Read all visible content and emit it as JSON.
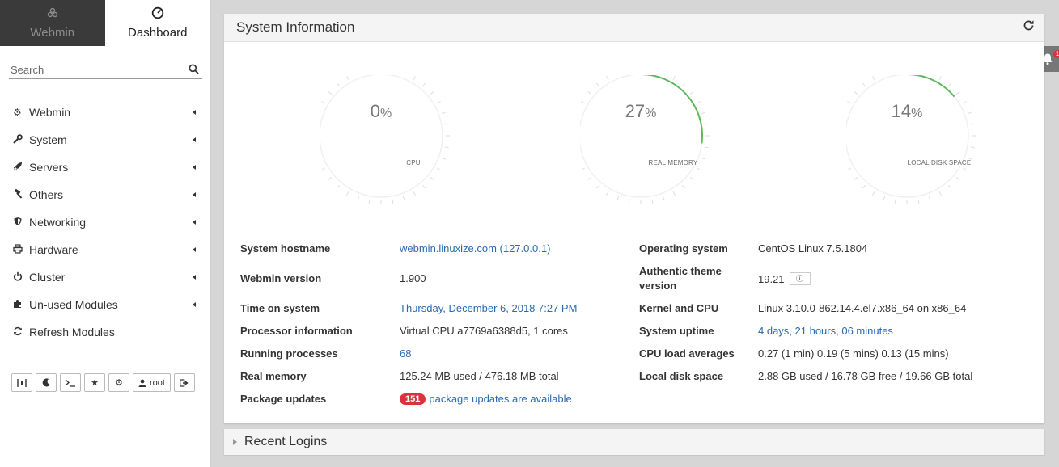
{
  "sidebar": {
    "tabs": [
      {
        "label": "Webmin",
        "icon": "webmin-logo-icon"
      },
      {
        "label": "Dashboard",
        "icon": "dashboard-icon"
      }
    ],
    "search": {
      "placeholder": "Search"
    },
    "menu": [
      {
        "label": "Webmin",
        "icon": "gear-icon"
      },
      {
        "label": "System",
        "icon": "wrench-icon"
      },
      {
        "label": "Servers",
        "icon": "rocket-icon"
      },
      {
        "label": "Others",
        "icon": "hammer-icon"
      },
      {
        "label": "Networking",
        "icon": "shield-icon"
      },
      {
        "label": "Hardware",
        "icon": "printer-icon"
      },
      {
        "label": "Cluster",
        "icon": "power-icon"
      },
      {
        "label": "Un-used Modules",
        "icon": "puzzle-icon"
      },
      {
        "label": "Refresh Modules",
        "icon": "refresh-icon"
      }
    ],
    "toolbar": {
      "user": "root"
    }
  },
  "panel": {
    "title": "System Information",
    "gauges": [
      {
        "value": "0",
        "unit": "%",
        "label": "CPU",
        "percent": 0
      },
      {
        "value": "27",
        "unit": "%",
        "label": "REAL MEMORY",
        "percent": 27
      },
      {
        "value": "14",
        "unit": "%",
        "label": "LOCAL DISK SPACE",
        "percent": 14
      }
    ],
    "info_left": [
      {
        "key": "System hostname",
        "value": "webmin.linuxize.com (127.0.0.1)",
        "link": true
      },
      {
        "key": "Webmin version",
        "value": "1.900",
        "link": false
      },
      {
        "key": "Time on system",
        "value": "Thursday, December 6, 2018 7:27 PM",
        "link": true
      },
      {
        "key": "Processor information",
        "value": "Virtual CPU a7769a6388d5, 1 cores",
        "link": false
      },
      {
        "key": "Running processes",
        "value": "68",
        "link": true
      },
      {
        "key": "Real memory",
        "value": "125.24 MB used / 476.18 MB total",
        "link": false
      },
      {
        "key": "Package updates",
        "badge": "151",
        "value": "package updates are available",
        "link": true
      }
    ],
    "info_right": [
      {
        "key": "Operating system",
        "value": "CentOS Linux 7.5.1804",
        "link": false
      },
      {
        "key_line1": "Authentic theme",
        "key_line2": "version",
        "value": "19.21",
        "link": false
      },
      {
        "key": "Kernel and CPU",
        "value": "Linux 3.10.0-862.14.4.el7.x86_64 on x86_64",
        "link": false
      },
      {
        "key": "System uptime",
        "value": "4 days, 21 hours, 06 minutes",
        "link": true
      },
      {
        "key": "CPU load averages",
        "value": "0.27 (1 min) 0.19 (5 mins) 0.13 (15 mins)",
        "link": false
      },
      {
        "key": "Local disk space",
        "value": "2.88 GB used / 16.78 GB free / 19.66 GB total",
        "link": false
      }
    ]
  },
  "recent": {
    "title": "Recent Logins"
  },
  "notifications": {
    "count": "1"
  },
  "colors": {
    "link": "#2a6ab0",
    "gauge_arc": "#5cb85c",
    "badge": "#d9333d",
    "sidebar_dark": "#3a3a3a"
  }
}
